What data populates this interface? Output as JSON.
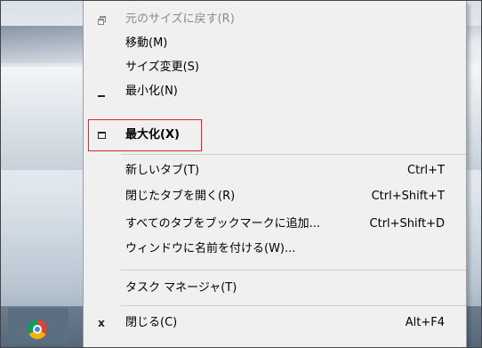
{
  "context_menu": {
    "items": [
      {
        "icon": "restore-icon",
        "label": "元のサイズに戻す(R)",
        "shortcut": "",
        "disabled": true
      },
      {
        "icon": "",
        "label": "移動(M)",
        "shortcut": ""
      },
      {
        "icon": "",
        "label": "サイズ変更(S)",
        "shortcut": ""
      },
      {
        "icon": "minimize-icon",
        "label": "最小化(N)",
        "shortcut": ""
      },
      {
        "icon": "maximize-icon",
        "label": "最大化(X)",
        "shortcut": "",
        "bold": true
      },
      {
        "icon": "",
        "label": "新しいタブ(T)",
        "shortcut": "Ctrl+T"
      },
      {
        "icon": "",
        "label": "閉じたタブを開く(R)",
        "shortcut": "Ctrl+Shift+T"
      },
      {
        "icon": "",
        "label": "すべてのタブをブックマークに追加...",
        "shortcut": "Ctrl+Shift+D"
      },
      {
        "icon": "",
        "label": "ウィンドウに名前を付ける(W)...",
        "shortcut": ""
      },
      {
        "icon": "",
        "label": "タスク マネージャ(T)",
        "shortcut": ""
      },
      {
        "icon": "close-icon",
        "label": "閉じる(C)",
        "shortcut": "Alt+F4"
      }
    ]
  },
  "highlight_color": "#e02424",
  "taskbar": {
    "app_icon": "chrome-icon"
  }
}
